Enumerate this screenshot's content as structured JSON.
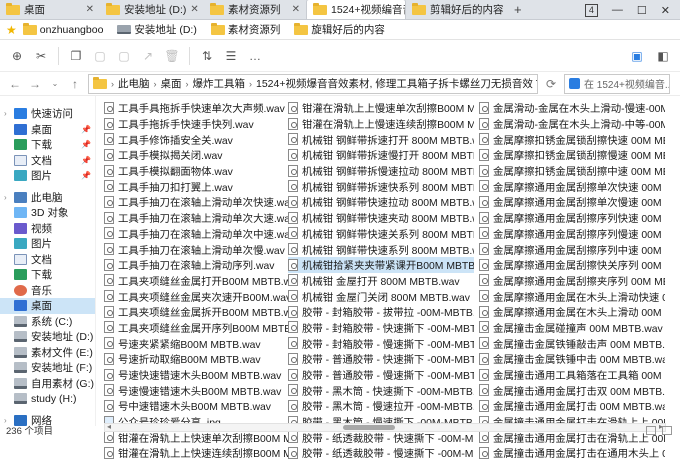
{
  "tabs": [
    {
      "label": "桌面",
      "active": false
    },
    {
      "label": "安装地址 (D:)",
      "active": false
    },
    {
      "label": "素材资源列",
      "active": false
    },
    {
      "label": "1524+视频编音音",
      "active": true
    },
    {
      "label": "剪辑好后的内容",
      "active": false
    }
  ],
  "tab_new": "+",
  "window": {
    "badge": "4",
    "minimize": "—",
    "maximize": "☐",
    "close": "✕"
  },
  "bookmarks": [
    {
      "label": "onzhuangboo",
      "icon": "star-icon"
    },
    {
      "label": "安装地址 (D:)",
      "icon": "drive-icon"
    },
    {
      "label": "素材资源列",
      "icon": "folder-icon"
    },
    {
      "label": "旋辑好后的内容",
      "icon": "folder-icon"
    }
  ],
  "address": {
    "crumbs": [
      "此电脑",
      "桌面",
      "爆炸工具箱",
      "1524+视频爆音音效素材, 修理工具箱子拆卡螺丝刀无损音效 Toolbos"
    ],
    "search_placeholder": "在 1524+视频编音..."
  },
  "sidebar": [
    {
      "label": "快速访问",
      "icon": "star-icon",
      "type": "header"
    },
    {
      "label": "桌面",
      "icon": "desktop-icon",
      "pin": true
    },
    {
      "label": "下载",
      "icon": "download-icon",
      "pin": true
    },
    {
      "label": "文档",
      "icon": "document-icon",
      "pin": true
    },
    {
      "label": "图片",
      "icon": "picture-icon",
      "pin": true
    },
    {
      "label": "此电脑",
      "icon": "computer-icon",
      "type": "header",
      "gap": true
    },
    {
      "label": "3D 对象",
      "icon": "cube-icon"
    },
    {
      "label": "视频",
      "icon": "video-icon"
    },
    {
      "label": "图片",
      "icon": "picture-icon"
    },
    {
      "label": "文档",
      "icon": "document-icon"
    },
    {
      "label": "下载",
      "icon": "download-icon"
    },
    {
      "label": "音乐",
      "icon": "music-icon"
    },
    {
      "label": "桌面",
      "icon": "desktop-icon",
      "selected": true
    },
    {
      "label": "系统 (C:)",
      "icon": "drive-icon"
    },
    {
      "label": "安装地址 (D:)",
      "icon": "drive-icon"
    },
    {
      "label": "素材文件 (E:)",
      "icon": "drive-icon"
    },
    {
      "label": "安装地址 (F:)",
      "icon": "drive-icon"
    },
    {
      "label": "自用素材 (G:)",
      "icon": "drive-icon"
    },
    {
      "label": "study (H:)",
      "icon": "drive-icon"
    },
    {
      "label": "网络",
      "icon": "network-icon",
      "type": "header",
      "gap": true
    }
  ],
  "columns": [
    [
      {
        "name": "工具手具拖拆手快速单次大声频.wav"
      },
      {
        "name": "工具手拖拆手快速手快列.wav"
      },
      {
        "name": "工具手修饰插安全关.wav"
      },
      {
        "name": "工具手模拟揭关闭.wav"
      },
      {
        "name": "工具手模拟翻面物体.wav"
      },
      {
        "name": "工具手抽刀扣打翼上.wav"
      },
      {
        "name": "工具手抽刀在滚轴上滑动单次快速.wav"
      },
      {
        "name": "工具手抽刀在滚轴上滑动单次大速.wav"
      },
      {
        "name": "工具手抽刀在滚轴上滑动单次中速.wav"
      },
      {
        "name": "工具手抽刀在滚轴上滑动单次慢.wav"
      },
      {
        "name": "工具手抽刀在滚轴上滑动序列.wav"
      },
      {
        "name": "工具夹项缝丝金属打开B00M MBTB.wav"
      },
      {
        "name": "工具夹项缝丝金属夹次速开B00M.wav"
      },
      {
        "name": "工具夹项缝丝金属拆开B00M MBTB.wav"
      },
      {
        "name": "工具夹项缝丝金属开序列B00M MBTB.wav"
      },
      {
        "name": "号速夹紧紧缩B00M MBTB.wav"
      },
      {
        "name": "号速折动取缩B00M MBTB.wav"
      },
      {
        "name": "号速快速错速木头B00M MBTB.wav"
      },
      {
        "name": "号速慢速错速木头B00M MBTB.wav"
      },
      {
        "name": "号中速错速木头B00M MBTB.wav"
      },
      {
        "name": "公众号珍珍爱分享 .jpg",
        "kind": "jpg"
      },
      {
        "name": "钳灌在滑轨上上快速单次刮擦B00M MBTB.wav"
      },
      {
        "name": "钳灌在滑轨上上快速连续刮擦B00M MBTB.wav"
      }
    ],
    [
      {
        "name": "钳灌在滑轨上上慢速单次刮擦B00M MBTB.wav"
      },
      {
        "name": "钳灌在滑轨上上慢速连续刮擦B00M MBTB.wav"
      },
      {
        "name": "机械钳 钢鲜带拆速打开 800M MBTB.wav"
      },
      {
        "name": "机械钳 钢鲜带拆速慢打开 800M MBTB.wav"
      },
      {
        "name": "机械钳 钢鲜带拆慢速拉动 800M MBTB.wav"
      },
      {
        "name": "机械钳 钢鲜带拆速快系列 800M MBTB.wav"
      },
      {
        "name": "机械钳 钢鲜带快速拉动 800M MBTB.wav"
      },
      {
        "name": "机械钳 钢鲜带快速夹动 800M MBTB.wav"
      },
      {
        "name": "机械钳 钢鲜带快速关系列 800M MBTB.wav"
      },
      {
        "name": "机械钳 钢鲜带快速系列 800M MBTB.wav"
      },
      {
        "name": "机械钳拾紧夹夹带紧课开B00M MBTB.wav",
        "selected": true
      },
      {
        "name": "机械钳 金屋打开 800M MBTB.wav"
      },
      {
        "name": "机械钳 金屋门关闭 800M MBTB.wav"
      },
      {
        "name": "胶带 - 封箱胶带 - 拔带拉 -00M-MBTB.wav"
      },
      {
        "name": "胶带 - 封箱胶带 - 快速撕下 -00M-MBTB.wav"
      },
      {
        "name": "胶带 - 封箱胶带 - 慢速撕下 -00M-MBTB.wav"
      },
      {
        "name": "胶带 - 普通胶带 - 快速撕下 -00M-MBTB.wav"
      },
      {
        "name": "胶带 - 普通胶带 - 慢速撕下 -00M-MBTB.wav"
      },
      {
        "name": "胶带 - 黑木筒 - 快速撕下 -00M-MBTB.wav"
      },
      {
        "name": "胶带 - 黑木筒 - 慢速拉开 -00M-MBTB.wav"
      },
      {
        "name": "胶带 - 黑木筒 - 慢速撕下 -00M-MBTB.wav"
      },
      {
        "name": "胶带 - 纸透裁胶带 - 快速撕下 -00M-MBTB.wav"
      },
      {
        "name": "胶带 - 纸透裁胶带 - 慢速撕下 -00M-MBTB.wav"
      }
    ],
    [
      {
        "name": "金属滑动-金属在木头上滑动-慢速-00M-MBTB.wav"
      },
      {
        "name": "金属滑动-金属在木头上滑动-中等-00M-MBTB.wav"
      },
      {
        "name": "金属摩擦扣锈金属锁刮擦快速 00M MBTB.wav"
      },
      {
        "name": "金属摩擦扣锈金属锁刮擦慢速 00M MBTB.wav"
      },
      {
        "name": "金属摩擦扣锈金属锁刮擦中速 00M MBTB.wav"
      },
      {
        "name": "金属摩擦通用金属刮擦单次快速 00M MBTB.wav"
      },
      {
        "name": "金属摩擦通用金属刮擦单次慢速 00M MBTB.wav"
      },
      {
        "name": "金属摩擦通用金属刮擦序列快速 00M MBTB.wav"
      },
      {
        "name": "金属摩擦通用金属刮擦序列慢速 00M MBTB.wav"
      },
      {
        "name": "金属摩擦通用金属刮擦序列中速 00M MBTB.wav"
      },
      {
        "name": "金属摩擦通用金属刮擦快关序列 00M MBTB.wav"
      },
      {
        "name": "金属摩擦通用金属刮擦夹序列 00M MBTB.wav"
      },
      {
        "name": "金属摩擦通用金属在木头上滑动快速 00M.wav"
      },
      {
        "name": "金属摩擦通用金属在木头上滑动 00M MBTB.wav"
      },
      {
        "name": "金属撞击金属碰撞声 00M MBTB.wav"
      },
      {
        "name": "金属撞击金属铁锤敲击声 00M MBTB.wav"
      },
      {
        "name": "金属撞击金属铁锤中击 00M MBTB.wav"
      },
      {
        "name": "金属撞击通用工具箱落在工具箱 00M MBTB.wav"
      },
      {
        "name": "金属撞击通用金属打击双 00M MBTB.wav"
      },
      {
        "name": "金属撞击通用金属打击 00M MBTB.wav"
      },
      {
        "name": "金属撞击通用金属打击在滑轨上上 00M MBTB.wav"
      },
      {
        "name": "金属撞击通用金属打击在滑轨上上 00M MBTB.wav"
      },
      {
        "name": "金属撞击通用金属打击在通用木头上 00M MBTB.wav"
      }
    ]
  ],
  "status": {
    "count": "236 个项目"
  }
}
